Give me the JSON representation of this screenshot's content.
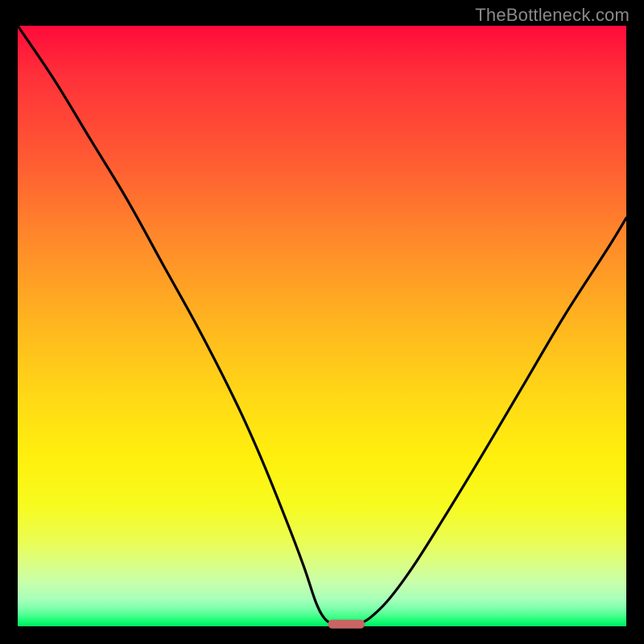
{
  "branding": {
    "watermark": "TheBottleneck.com"
  },
  "colors": {
    "frame": "#000000",
    "curve": "#000000",
    "marker": "#c86464",
    "gradient_stops": [
      "#ff0a3a",
      "#ff5a33",
      "#ffb71f",
      "#fff00d",
      "#eafd55",
      "#a7ffb9",
      "#1aff75",
      "#00e763"
    ]
  },
  "chart_data": {
    "type": "line",
    "title": "",
    "xlabel": "",
    "ylabel": "",
    "xlim": [
      0,
      100
    ],
    "ylim": [
      0,
      100
    ],
    "grid": false,
    "legend": false,
    "series": [
      {
        "name": "left-branch",
        "x": [
          0,
          6,
          12,
          18,
          24,
          30,
          36,
          40,
          44,
          47,
          49,
          50.5,
          52
        ],
        "y": [
          100,
          91,
          81,
          71,
          60,
          49,
          37,
          28,
          18,
          10,
          4,
          1.2,
          0.3
        ]
      },
      {
        "name": "right-branch",
        "x": [
          56,
          58,
          61,
          65,
          70,
          76,
          83,
          90,
          97,
          100
        ],
        "y": [
          0.3,
          1.5,
          4.5,
          10,
          18,
          28,
          40,
          52,
          63,
          68
        ]
      }
    ],
    "marker": {
      "name": "min-marker",
      "x_range": [
        51,
        57
      ],
      "y": 0.3,
      "shape": "rounded-bar"
    }
  }
}
